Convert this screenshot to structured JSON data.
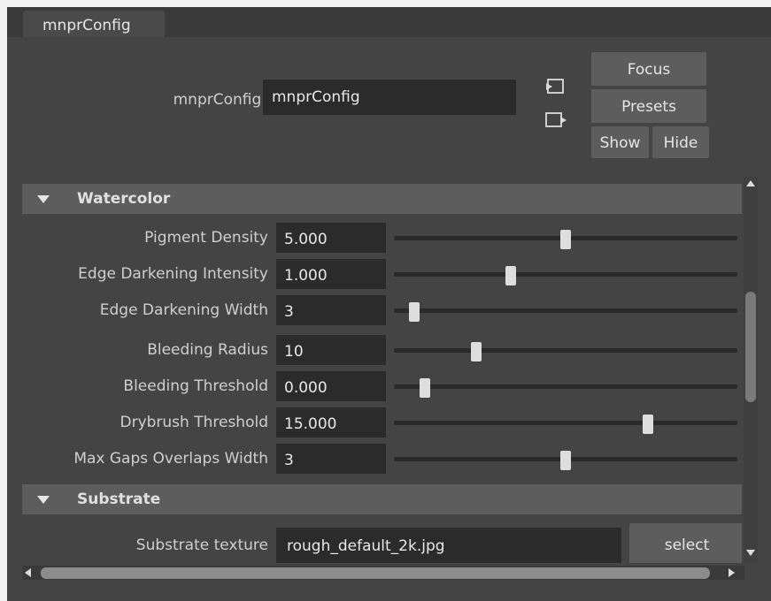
{
  "tab": {
    "label": "mnprConfig"
  },
  "node": {
    "label": "mnprConfig:",
    "value": "mnprConfig"
  },
  "icons": {
    "input_connection": "input-connection-icon",
    "output_connection": "output-connection-icon"
  },
  "buttons": {
    "focus": "Focus",
    "presets": "Presets",
    "show": "Show",
    "hide": "Hide",
    "select": "select"
  },
  "watercolor": {
    "title": "Watercolor",
    "attributes": [
      {
        "label": "Pigment Density",
        "value": "5.000",
        "slider": 0.5
      },
      {
        "label": "Edge Darkening Intensity",
        "value": "1.000",
        "slider": 0.34
      },
      {
        "label": "Edge Darkening Width",
        "value": "3",
        "slider": 0.06
      },
      {
        "label": "Bleeding Radius",
        "value": "10",
        "slider": 0.24
      },
      {
        "label": "Bleeding Threshold",
        "value": "0.000",
        "slider": 0.09
      },
      {
        "label": "Drybrush Threshold",
        "value": "15.000",
        "slider": 0.74
      },
      {
        "label": "Max Gaps Overlaps Width",
        "value": "3",
        "slider": 0.5
      }
    ]
  },
  "substrate": {
    "title": "Substrate",
    "texture_label": "Substrate texture",
    "texture_value": "rough_default_2k.jpg"
  }
}
